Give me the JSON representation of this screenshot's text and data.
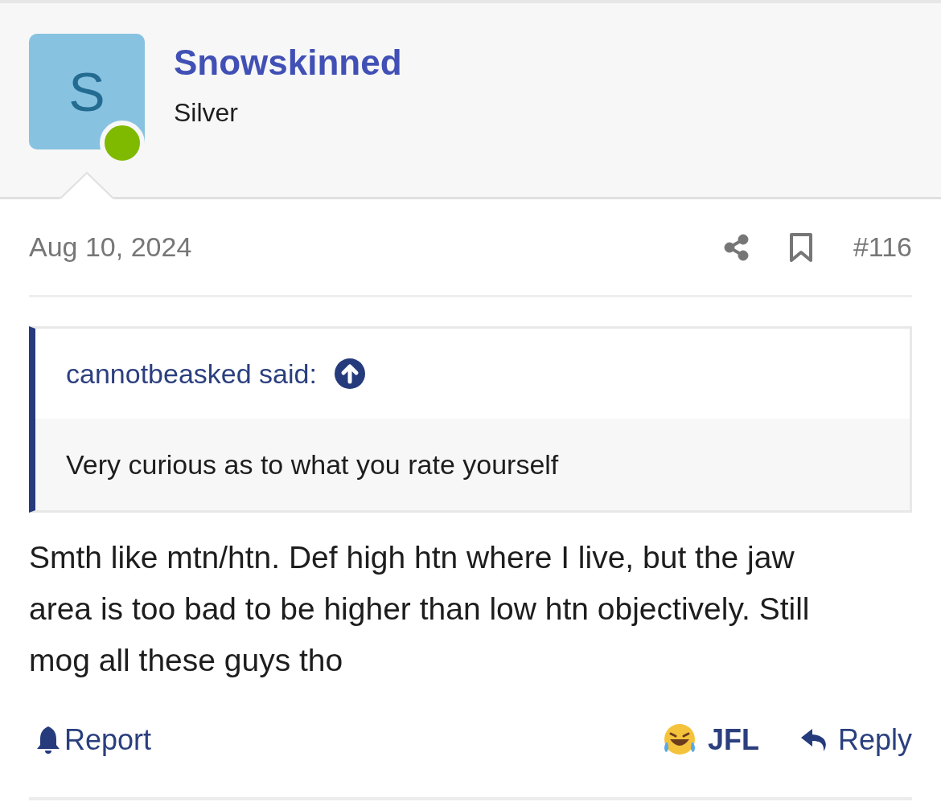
{
  "author": {
    "initial": "S",
    "name": "Snowskinned",
    "title": "Silver",
    "online": true
  },
  "post": {
    "date": "Aug 10, 2024",
    "number": "#116"
  },
  "quote": {
    "attribution": "cannotbeasked said:",
    "text": "Very curious as to what you rate yourself"
  },
  "body": "Smth like mtn/htn. Def high htn where I live, but the jaw area is too bad to be higher than low htn objectively. Still mog all these guys tho",
  "actions": {
    "report": "Report",
    "reaction": "JFL",
    "reply": "Reply"
  }
}
